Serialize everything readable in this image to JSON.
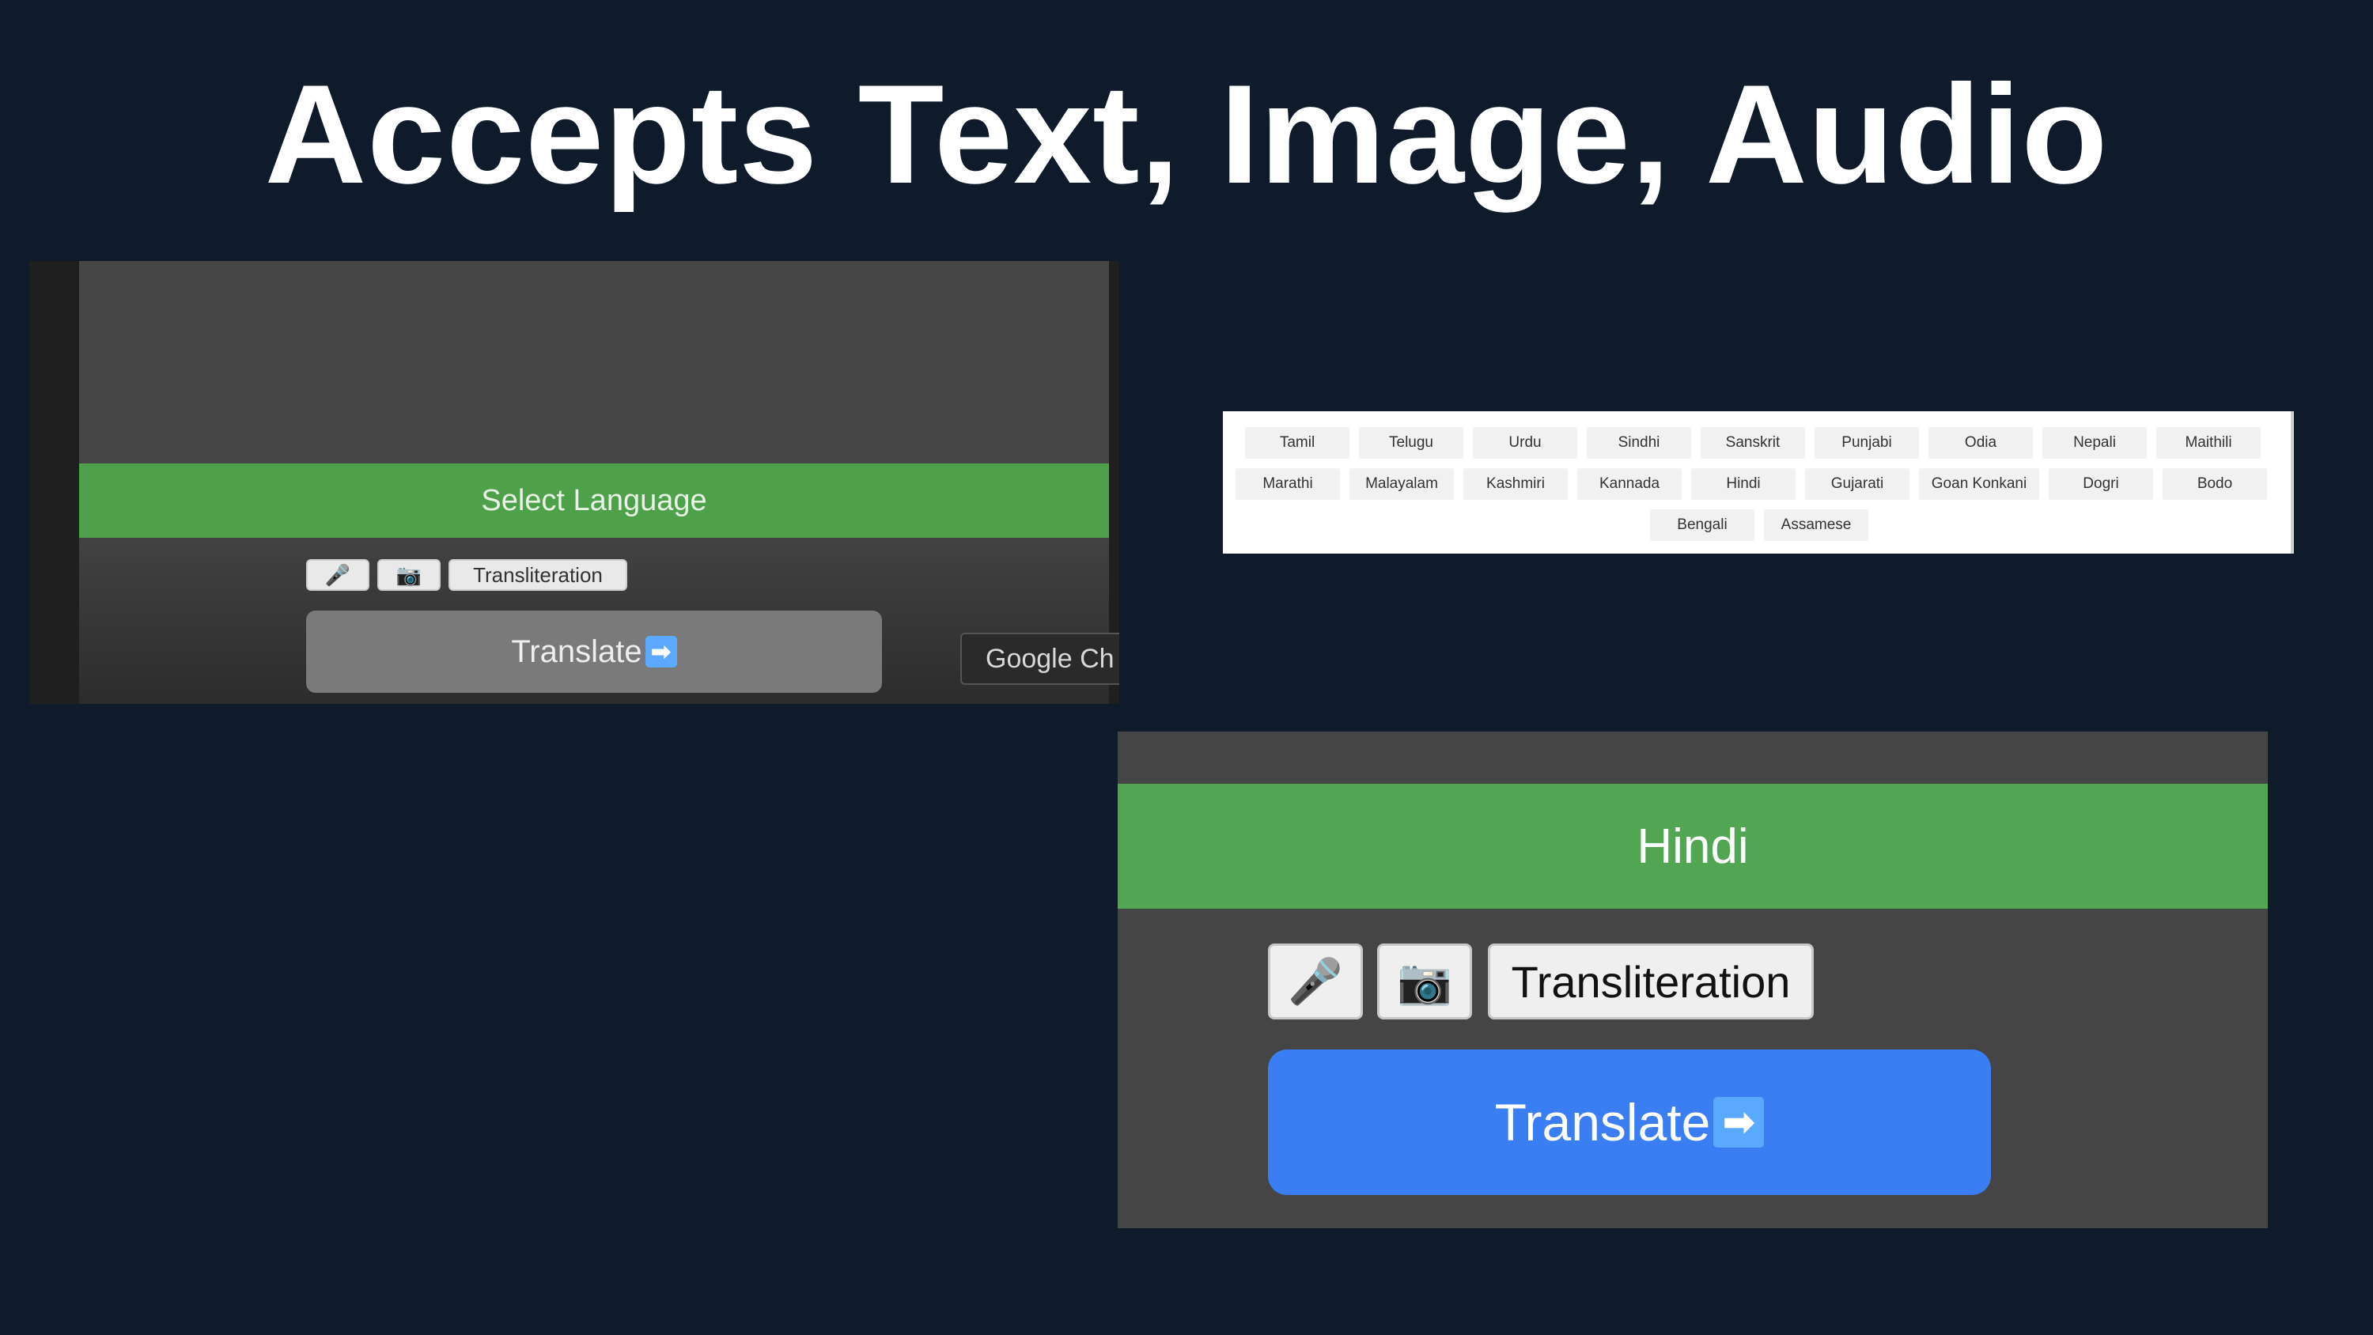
{
  "slide": {
    "title": "Accepts Text, Image, Audio"
  },
  "screenshot_1": {
    "language_button": "Select Language",
    "mic_button": "🎤",
    "camera_button": "📷",
    "transliteration_button": "Transliteration",
    "translate_button": "Translate",
    "translate_arrow": "➡",
    "tooltip_text": "Google Ch"
  },
  "screenshot_2": {
    "languages": [
      "Tamil",
      "Telugu",
      "Urdu",
      "Sindhi",
      "Sanskrit",
      "Punjabi",
      "Odia",
      "Nepali",
      "Maithili",
      "Marathi",
      "Malayalam",
      "Kashmiri",
      "Kannada",
      "Hindi",
      "Gujarati",
      "Goan Konkani",
      "Dogri",
      "Bodo",
      "Bengali",
      "Assamese"
    ]
  },
  "screenshot_3": {
    "language_button": "Hindi",
    "mic_button": "🎤",
    "camera_button": "📷",
    "transliteration_button": "Transliteration",
    "translate_button": "Translate",
    "translate_arrow": "➡"
  },
  "colors": {
    "background": "#0f1b2a",
    "green": "#52a553",
    "blue": "#3b7ef4"
  }
}
